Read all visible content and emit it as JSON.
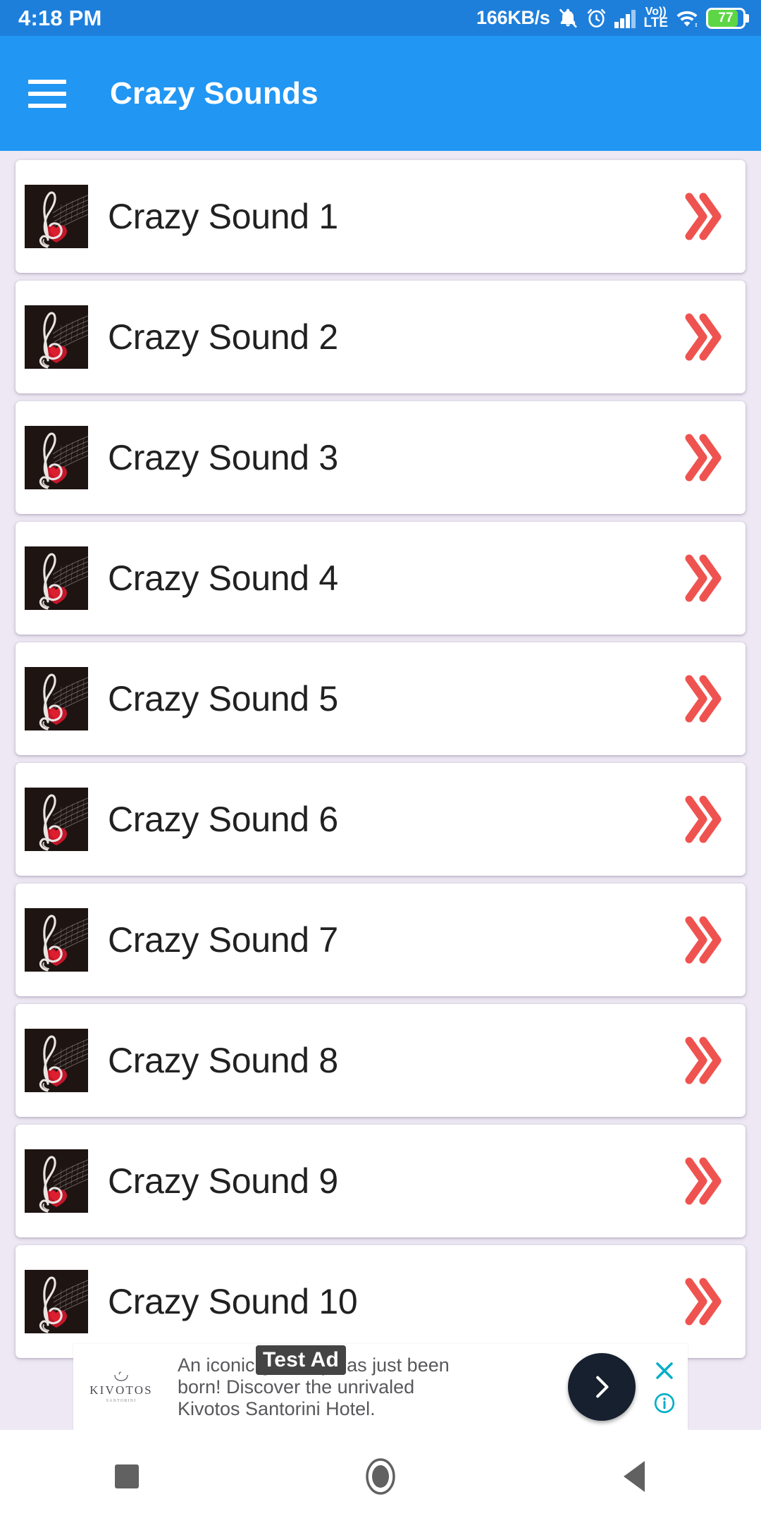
{
  "status_bar": {
    "clock": "4:18 PM",
    "net_speed": "166KB/s",
    "battery_level": "77",
    "icons": [
      "bell-mute-icon",
      "alarm-icon",
      "signal-bars-icon",
      "volte-icon",
      "wifi-icon",
      "battery-icon"
    ],
    "volte_top": "Vo))",
    "volte_bottom": "LTE",
    "background_color": "#1E7FDB",
    "text_color": "#FFFFFF"
  },
  "app_bar": {
    "menu_icon": "hamburger-menu-icon",
    "title": "Crazy Sounds",
    "background_color": "#2196F3",
    "text_color": "#FFFFFF"
  },
  "theme": {
    "page_background": "#EDE8F3",
    "card_background": "#FFFFFF",
    "chevron_color": "#EF5350",
    "list_text_color": "#212121"
  },
  "list": {
    "item_icon": "double-chevron-right-icon",
    "thumbnail_icon": "treble-clef-heart-thumbnail",
    "items": [
      {
        "label": "Crazy Sound 1"
      },
      {
        "label": "Crazy Sound 2"
      },
      {
        "label": "Crazy Sound 3"
      },
      {
        "label": "Crazy Sound 4"
      },
      {
        "label": "Crazy Sound 5"
      },
      {
        "label": "Crazy Sound 6"
      },
      {
        "label": "Crazy Sound 7"
      },
      {
        "label": "Crazy Sound 8"
      },
      {
        "label": "Crazy Sound 9"
      },
      {
        "label": "Crazy Sound 10"
      }
    ]
  },
  "ad": {
    "badge": "Test Ad",
    "advertiser": "KIVOTOS",
    "advertiser_subtitle": "SANTORINI",
    "logo_icon": "kivotos-boat-logo-icon",
    "body_line_1": "An iconic getaway has just been",
    "body_line_2": "born! Discover the unrivaled",
    "body_line_3": "Kivotos Santorini Hotel.",
    "cta_icon": "chevron-right-icon",
    "close_icon": "close-x-icon",
    "info_icon": "ad-info-icon",
    "cta_background": "#16202E",
    "control_color": "#00AEC7"
  },
  "nav_bar": {
    "recents_label": "recents-square-icon",
    "home_label": "home-circle-icon",
    "back_label": "back-triangle-icon",
    "icon_color": "#616161",
    "background_color": "#FFFFFF"
  }
}
